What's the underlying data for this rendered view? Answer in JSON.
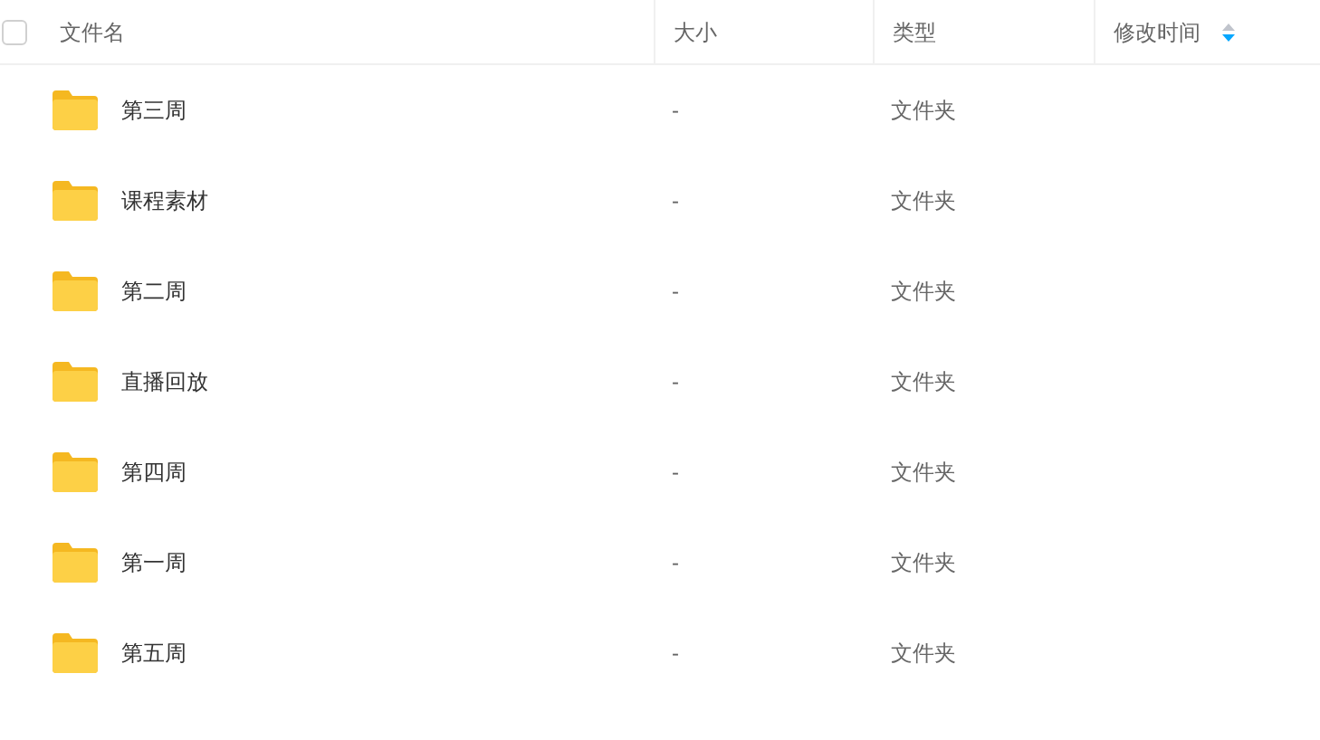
{
  "select_all": {
    "checked": false
  },
  "columns": [
    {
      "label": "文件名"
    },
    {
      "label": "大小"
    },
    {
      "label": "类型"
    },
    {
      "label": "修改时间",
      "sort_descending": true
    }
  ],
  "rows": [
    {
      "name": "第三周",
      "size": "-",
      "type": "文件夹"
    },
    {
      "name": "课程素材",
      "size": "-",
      "type": "文件夹"
    },
    {
      "name": "第二周",
      "size": "-",
      "type": "文件夹"
    },
    {
      "name": "直播回放",
      "size": "-",
      "type": "文件夹"
    },
    {
      "name": "第四周",
      "size": "-",
      "type": "文件夹"
    },
    {
      "name": "第一周",
      "size": "-",
      "type": "文件夹"
    },
    {
      "name": "第五周",
      "size": "-",
      "type": "文件夹"
    }
  ]
}
